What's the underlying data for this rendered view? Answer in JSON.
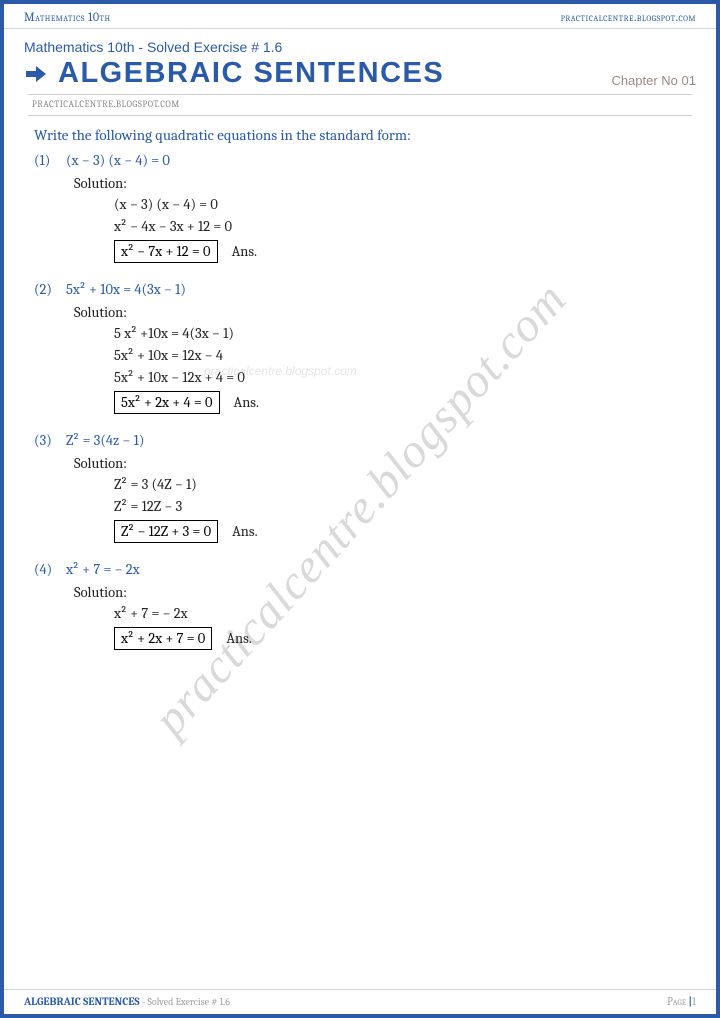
{
  "header": {
    "left": "Mathematics 10th",
    "right": "practicalcentre.blogspot.com"
  },
  "title": {
    "subtitle": "Mathematics 10th - Solved Exercise # 1.6",
    "main": "ALGEBRAIC SENTENCES",
    "chapter": "Chapter No 01"
  },
  "subheader": "PRACTICALCENTRE.BLOGSPOT.COM",
  "instruction": "Write the following quadratic equations in the standard form:",
  "watermark": "practicalcentre.blogspot.com",
  "watermark2": "practicalcentre.blogspot.com",
  "problems": [
    {
      "num": "(1)",
      "question": "(x − 3) (x − 4) = 0",
      "solution_label": "Solution:",
      "steps": [
        "(x − 3) (x − 4) = 0",
        "x² − 4x − 3x + 12 = 0"
      ],
      "boxed": "x²  −  7x +  12 =  0",
      "ans": "Ans."
    },
    {
      "num": "(2)",
      "question": "5x² + 10x = 4(3x − 1)",
      "solution_label": "Solution:",
      "steps": [
        "5 x² +10x = 4(3x − 1)",
        "5x² + 10x = 12x − 4",
        "5x² + 10x − 12x + 4 = 0"
      ],
      "boxed": "5x²  +  2x +  4  =  0",
      "ans": "Ans."
    },
    {
      "num": "(3)",
      "question": "Z² = 3(4z − 1)",
      "solution_label": "Solution:",
      "steps": [
        "Z² = 3 (4Z − 1)",
        "Z² = 12Z − 3"
      ],
      "boxed": "Z²  −  12Z +  3  =  0",
      "ans": "Ans."
    },
    {
      "num": "(4)",
      "question": "x² + 7 = − 2x",
      "solution_label": "Solution:",
      "steps": [
        "x² + 7 = − 2x"
      ],
      "boxed": "x²  +  2x +  7  =  0",
      "ans": "Ans."
    }
  ],
  "footer": {
    "left_bold": "ALGEBRAIC SENTENCES",
    "left_dim": " - Solved Exercise # 1.6",
    "right_label": "Page ",
    "right_bar": "|",
    "right_num": "1"
  }
}
